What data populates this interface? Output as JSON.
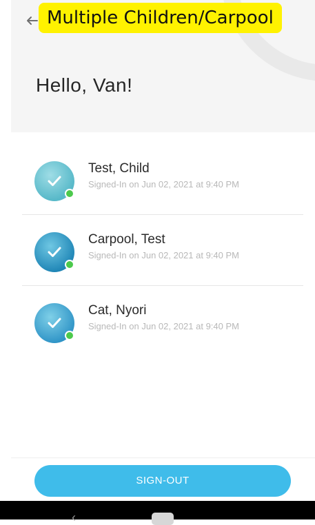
{
  "banner": {
    "text": "Multiple Children/Carpool"
  },
  "header": {
    "greeting": "Hello, Van!"
  },
  "icons": {
    "back": "arrow-left-icon",
    "check": "checkmark-icon",
    "online": "online-dot-icon"
  },
  "children": [
    {
      "name": "Test, Child",
      "status": "Signed-In on Jun 02, 2021 at 9:40 PM"
    },
    {
      "name": "Carpool, Test",
      "status": "Signed-In on Jun 02, 2021 at 9:40 PM"
    },
    {
      "name": "Cat, Nyori",
      "status": "Signed-In on Jun 02, 2021 at 9:40 PM"
    }
  ],
  "footer": {
    "signout_label": "SIGN-OUT"
  },
  "colors": {
    "accent": "#3fbcea",
    "online": "#4cc94c",
    "banner": "#fff200"
  }
}
